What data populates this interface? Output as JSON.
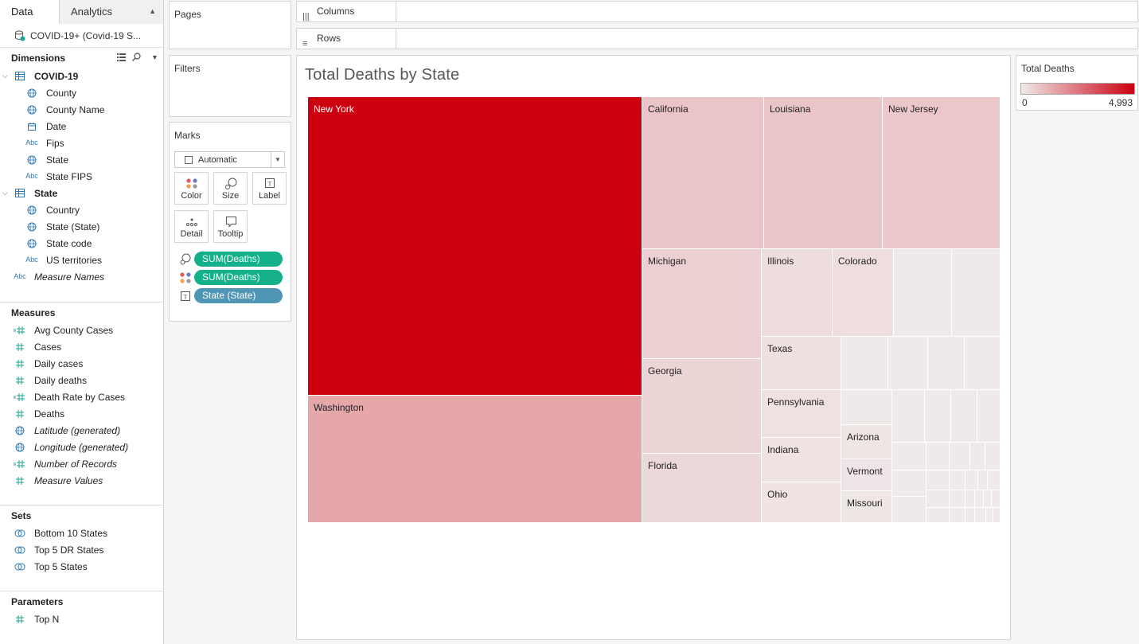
{
  "data_pane": {
    "tabs": [
      {
        "label": "Data"
      },
      {
        "label": "Analytics"
      }
    ],
    "datasource": "COVID-19+ (Covid-19 S...",
    "dimensions_title": "Dimensions",
    "dimensions": [
      {
        "label": "COVID-19",
        "icon": "table-icon",
        "kind": "table"
      },
      {
        "label": "County",
        "icon": "globe-icon"
      },
      {
        "label": "County Name",
        "icon": "globe-icon"
      },
      {
        "label": "Date",
        "icon": "calendar-icon"
      },
      {
        "label": "Fips",
        "icon": "Abc"
      },
      {
        "label": "State",
        "icon": "globe-icon"
      },
      {
        "label": "State FIPS",
        "icon": "Abc"
      },
      {
        "label": "State",
        "icon": "table-icon",
        "kind": "table"
      },
      {
        "label": "Country",
        "icon": "globe-icon"
      },
      {
        "label": "State (State)",
        "icon": "globe-icon"
      },
      {
        "label": "State code",
        "icon": "globe-icon"
      },
      {
        "label": "US territories",
        "icon": "Abc"
      },
      {
        "label": "Measure Names",
        "icon": "Abc",
        "italic": true
      }
    ],
    "measures_title": "Measures",
    "measures": [
      {
        "label": "Avg County Cases",
        "icon": "calc-hash-icon"
      },
      {
        "label": "Cases",
        "icon": "hash-icon"
      },
      {
        "label": "Daily cases",
        "icon": "hash-icon"
      },
      {
        "label": "Daily deaths",
        "icon": "hash-icon"
      },
      {
        "label": "Death Rate by Cases",
        "icon": "calc-hash-icon"
      },
      {
        "label": "Deaths",
        "icon": "hash-icon"
      },
      {
        "label": "Latitude (generated)",
        "icon": "globe-icon",
        "italic": true
      },
      {
        "label": "Longitude (generated)",
        "icon": "globe-icon",
        "italic": true
      },
      {
        "label": "Number of Records",
        "icon": "calc-hash-icon",
        "italic": true
      },
      {
        "label": "Measure Values",
        "icon": "hash-icon",
        "italic": true
      }
    ],
    "sets_title": "Sets",
    "sets": [
      {
        "label": "Bottom 10 States"
      },
      {
        "label": "Top 5 DR States"
      },
      {
        "label": "Top 5 States"
      }
    ],
    "parameters_title": "Parameters",
    "parameters": [
      {
        "label": "Top N"
      }
    ]
  },
  "shelves": {
    "pages": "Pages",
    "filters": "Filters",
    "columns": "Columns",
    "rows": "Rows",
    "marks": {
      "title": "Marks",
      "type": "Automatic",
      "buttons": [
        "Color",
        "Size",
        "Label",
        "Detail",
        "Tooltip"
      ],
      "pills": [
        {
          "label": "SUM(Deaths)",
          "icon": "size-icon",
          "color": "#13b089"
        },
        {
          "label": "SUM(Deaths)",
          "icon": "color-icon",
          "color": "#13b089"
        },
        {
          "label": "State (State)",
          "icon": "label-icon",
          "color": "#4f96b5"
        }
      ]
    }
  },
  "view": {
    "title": "Total Deaths by State"
  },
  "legend": {
    "title": "Total Deaths",
    "min": "0",
    "max": "4,993",
    "color_low": "#f0eaea",
    "color_high": "#cc0010"
  },
  "chart_data": {
    "type": "treemap",
    "title": "Total Deaths by State",
    "labeled_cells": [
      {
        "label": "New York",
        "value": 4993
      },
      {
        "label": "Washington",
        "value": 1440
      },
      {
        "label": "California",
        "value": 820
      },
      {
        "label": "Louisiana",
        "value": 780
      },
      {
        "label": "New Jersey",
        "value": 740
      },
      {
        "label": "Michigan",
        "value": 560
      },
      {
        "label": "Georgia",
        "value": 480
      },
      {
        "label": "Florida",
        "value": 390
      },
      {
        "label": "Illinois",
        "value": 280
      },
      {
        "label": "Colorado",
        "value": 250
      },
      {
        "label": "Texas",
        "value": 220
      },
      {
        "label": "Pennsylvania",
        "value": 190
      },
      {
        "label": "Indiana",
        "value": 170
      },
      {
        "label": "Ohio",
        "value": 150
      },
      {
        "label": "Arizona",
        "value": 110
      },
      {
        "label": "Vermont",
        "value": 100
      },
      {
        "label": "Missouri",
        "value": 90
      }
    ],
    "color_scale": {
      "min": 0,
      "max": 4993
    }
  }
}
